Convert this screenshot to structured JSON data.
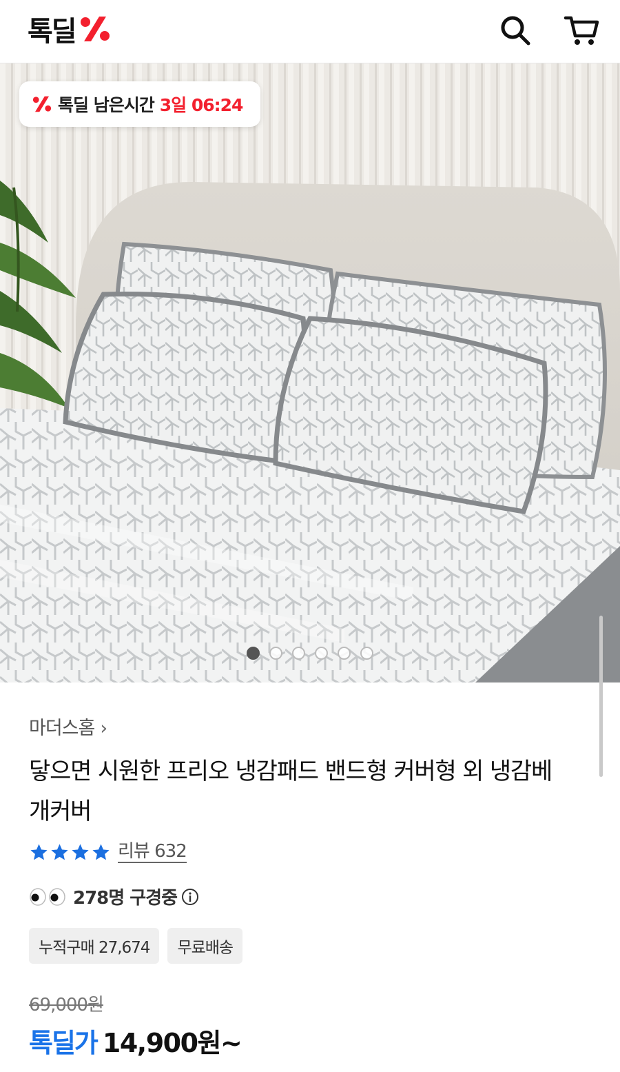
{
  "header": {
    "logo_text": "톡딜",
    "search_icon": "search-icon",
    "cart_icon": "cart-icon"
  },
  "hero": {
    "timer_label": "톡딜 남은시간",
    "timer_time": "3일 06:24",
    "carousel_total": 6,
    "carousel_active": 1
  },
  "product": {
    "brand": "마더스홈",
    "brand_chevron": "›",
    "title": "닿으면 시원한 프리오 냉감패드 밴드형 커버형 외 냉감베개커버",
    "rating_stars": 4,
    "review_label": "리뷰 632",
    "viewers_text": "278명 구경중",
    "chips": [
      "누적구매 27,674",
      "무료배송"
    ],
    "original_price": "69,000원",
    "sale_label": "톡딜가",
    "sale_price": "14,900원~"
  },
  "colors": {
    "accent_red": "#f3202e",
    "accent_blue": "#1a73e8",
    "star_blue": "#1b6fe0"
  }
}
